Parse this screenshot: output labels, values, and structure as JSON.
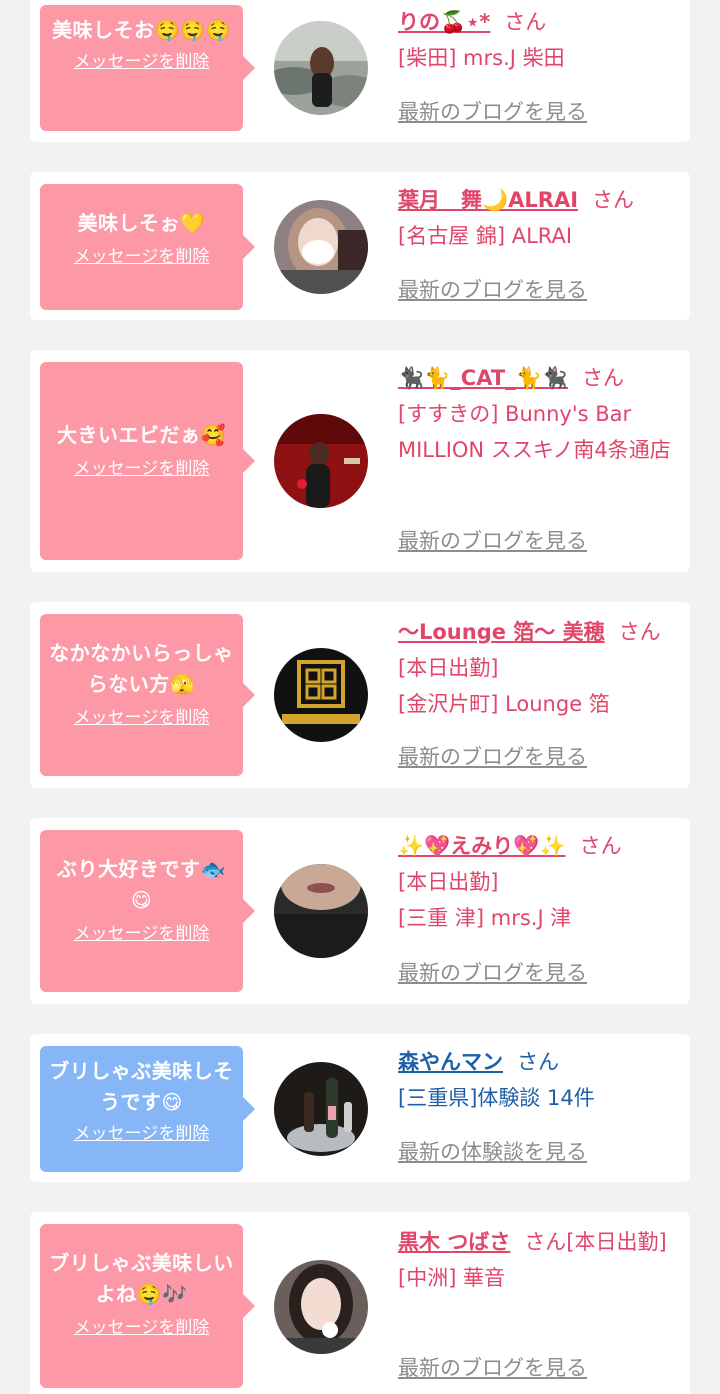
{
  "messages": [
    {
      "bubble_text": "美味しそお🤤🤤🤤",
      "delete_label": "メッセージを削除",
      "bubble_color": "pink",
      "avatar_icon": "woman-by-river-photo",
      "name": "りの🍒⋆*",
      "honorific": "さん",
      "lines": [
        "[柴田] mrs.J 柴田"
      ],
      "blog_link": "最新のブログを見る"
    },
    {
      "bubble_text": "美味しそぉ💛",
      "delete_label": "メッセージを削除",
      "bubble_color": "pink",
      "avatar_icon": "woman-with-mask-photo",
      "name": "葉月　舞🌙ALRAI",
      "honorific": "さん",
      "lines": [
        "[名古屋 錦] ALRAI"
      ],
      "blog_link": "最新のブログを見る"
    },
    {
      "bubble_text": "大きいエビだぁ🥰",
      "delete_label": "メッセージを削除",
      "bubble_color": "pink",
      "avatar_icon": "red-bar-photo",
      "name": "🐈‍⬛🐈_CAT_🐈🐈‍⬛",
      "honorific": "さん",
      "lines": [
        "[すすきの] Bunny's Bar MILLION ススキノ南4条通店"
      ],
      "blog_link": "最新のブログを見る"
    },
    {
      "bubble_text": "なかなかいらっしゃらない方🫣",
      "delete_label": "メッセージを削除",
      "bubble_color": "pink",
      "avatar_icon": "lounge-logo-photo",
      "name": "〜Lounge 箔〜 美穂",
      "honorific": "さん[本日出勤]",
      "lines": [
        "[金沢片町] Lounge 箔"
      ],
      "blog_link": "最新のブログを見る"
    },
    {
      "bubble_text": "ぶり大好きです🐟😋",
      "delete_label": "メッセージを削除",
      "bubble_color": "pink",
      "avatar_icon": "woman-closeup-photo",
      "name": "✨💖えみり💖✨",
      "honorific": "さん",
      "lines": [
        "[本日出勤]",
        "[三重 津] mrs.J 津"
      ],
      "blog_link": "最新のブログを見る"
    },
    {
      "bubble_text": "ブリしゃぶ美味しそうです😋",
      "delete_label": "メッセージを削除",
      "bubble_color": "blue",
      "avatar_icon": "champagne-bottle-photo",
      "name": "森やんマン",
      "honorific": "さん",
      "lines": [
        "[三重県]体験談 14件"
      ],
      "blog_link": "最新の体験談を見る"
    },
    {
      "bubble_text": "ブリしゃぶ美味しいよね🤤🎶",
      "delete_label": "メッセージを削除",
      "bubble_color": "pink",
      "avatar_icon": "woman-selfie-photo",
      "name": "黒木 つばさ",
      "honorific": "さん[本日出勤]",
      "lines": [
        "[中洲] 華音"
      ],
      "blog_link": "最新のブログを見る"
    }
  ]
}
